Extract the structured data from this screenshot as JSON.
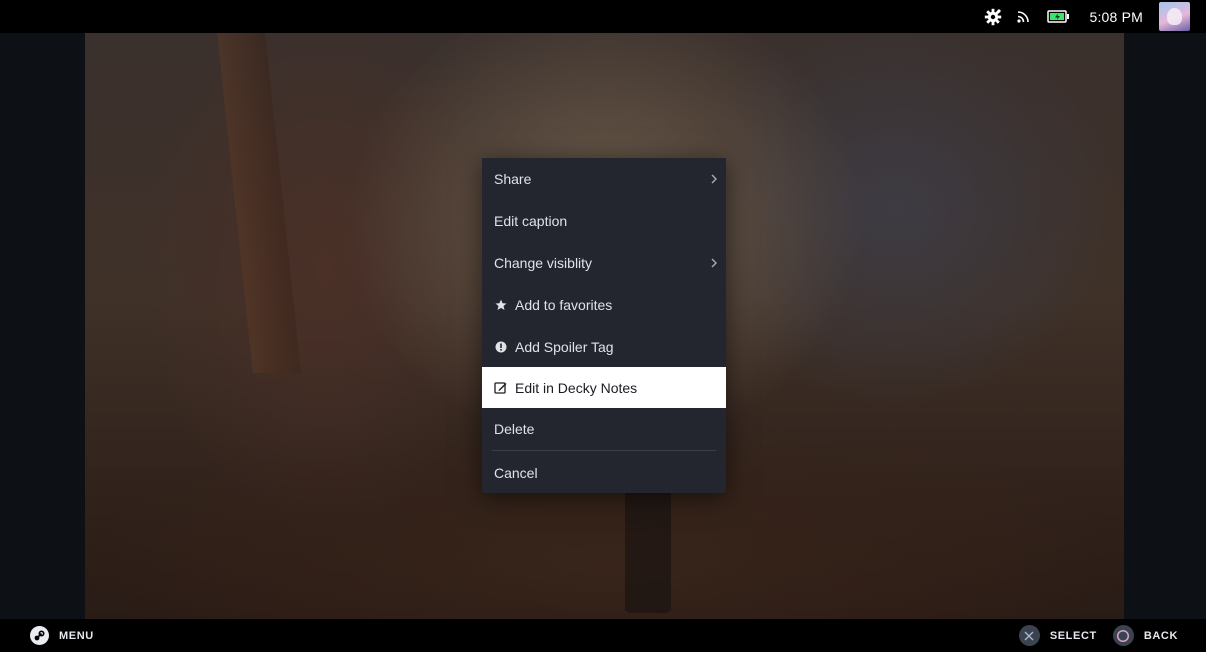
{
  "topbar": {
    "time": "5:08 PM",
    "icons": [
      "settings-gear-icon",
      "wifi-signal-icon",
      "battery-charging-icon"
    ],
    "battery_color": "#3fe36b"
  },
  "menu": {
    "items": [
      {
        "label": "Share",
        "icon": null,
        "has_submenu": true
      },
      {
        "label": "Edit caption",
        "icon": null,
        "has_submenu": false
      },
      {
        "label": "Change visiblity",
        "icon": null,
        "has_submenu": true
      },
      {
        "label": "Add to favorites",
        "icon": "star-icon",
        "has_submenu": false
      },
      {
        "label": "Add Spoiler Tag",
        "icon": "alert-circle-icon",
        "has_submenu": false
      },
      {
        "label": "Edit in Decky Notes",
        "icon": "edit-note-icon",
        "has_submenu": false,
        "focused": true
      },
      {
        "label": "Delete",
        "icon": null,
        "has_submenu": false
      },
      {
        "label": "Cancel",
        "icon": null,
        "has_submenu": false
      }
    ],
    "background_color": "#23262e",
    "focus_color": "#ffffff"
  },
  "bottombar": {
    "menu_label": "MENU",
    "select_label": "SELECT",
    "back_label": "BACK"
  }
}
